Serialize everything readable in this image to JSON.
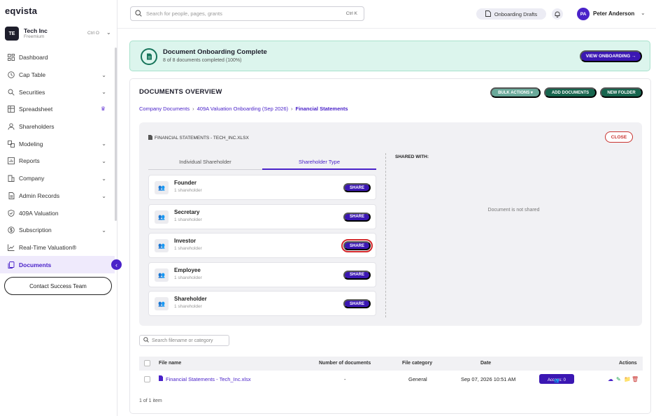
{
  "app": {
    "logo": "eqvista"
  },
  "org": {
    "initials": "TE",
    "name": "Tech Inc",
    "plan": "Freemium",
    "shortcut": "Ctrl O"
  },
  "search": {
    "placeholder": "Search for people, pages, grants",
    "shortcut": "Ctrl K"
  },
  "topbar": {
    "drafts_label": "Onboarding Drafts",
    "user_initials": "PA",
    "user_name": "Peter Anderson"
  },
  "sidebar": {
    "items": [
      {
        "label": "Dashboard",
        "icon": "grid-icon",
        "chevron": false
      },
      {
        "label": "Cap Table",
        "icon": "clock-icon",
        "chevron": true
      },
      {
        "label": "Securities",
        "icon": "search-doc-icon",
        "chevron": true
      },
      {
        "label": "Spreadsheet",
        "icon": "table-icon",
        "chevron": false,
        "crown": true
      },
      {
        "label": "Shareholders",
        "icon": "users-icon",
        "chevron": false
      },
      {
        "label": "Modeling",
        "icon": "model-icon",
        "chevron": true
      },
      {
        "label": "Reports",
        "icon": "report-icon",
        "chevron": true
      },
      {
        "label": "Company",
        "icon": "company-icon",
        "chevron": true
      },
      {
        "label": "Admin Records",
        "icon": "records-icon",
        "chevron": true
      },
      {
        "label": "409A Valuation",
        "icon": "shield-icon",
        "chevron": false
      },
      {
        "label": "Subscription",
        "icon": "dollar-icon",
        "chevron": true
      },
      {
        "label": "Real-Time Valuation®",
        "icon": "chart-icon",
        "chevron": false
      },
      {
        "label": "Documents",
        "icon": "documents-icon",
        "chevron": false,
        "active": true
      }
    ],
    "contact_label": "Contact Success Team"
  },
  "banner": {
    "title": "Document Onboarding Complete",
    "subtitle": "8 of 8 documents completed (100%)",
    "button": "VIEW ONBOARDING →"
  },
  "overview": {
    "title": "DOCUMENTS OVERVIEW",
    "bulk_label": "BULK ACTIONS",
    "add_label": "ADD DOCUMENTS",
    "folder_label": "NEW FOLDER",
    "breadcrumbs": [
      "Company Documents",
      "409A Valuation Onboarding (Sep 2026)",
      "Financial Statements"
    ]
  },
  "share_panel": {
    "file_name": "FINANCIAL STATEMENTS - TECH_INC.XLSX",
    "close_label": "CLOSE",
    "tabs": [
      "Individual Shareholder",
      "Shareholder Type"
    ],
    "shared_with_label": "SHARED WITH:",
    "empty_message": "Document is not shared",
    "share_label": "SHARE",
    "types": [
      {
        "name": "Founder",
        "count": "1 shareholder"
      },
      {
        "name": "Secretary",
        "count": "1 shareholder"
      },
      {
        "name": "Investor",
        "count": "1 shareholder"
      },
      {
        "name": "Employee",
        "count": "1 shareholder"
      },
      {
        "name": "Shareholder",
        "count": "1 shareholder"
      }
    ]
  },
  "files": {
    "search_placeholder": "Search filename or category",
    "columns": [
      "File name",
      "Number of documents",
      "File category",
      "Date",
      "Actions"
    ],
    "rows": [
      {
        "name": "Financial Statements - Tech_Inc.xlsx",
        "count": "-",
        "category": "General",
        "date": "Sep 07, 2026 10:51 AM",
        "access": "Access: 0"
      }
    ],
    "pager": "1 of 1 item"
  },
  "colors": {
    "accent": "#3b17b3",
    "green": "#17654e",
    "banner_bg": "#dcf5ed",
    "danger": "#c9332f"
  }
}
